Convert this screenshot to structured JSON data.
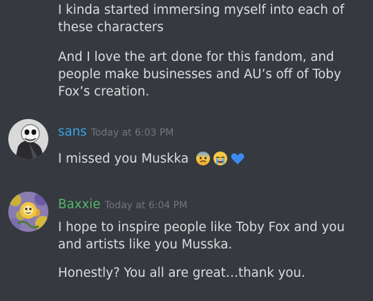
{
  "colors": {
    "background": "#36393f",
    "text": "#dcddde",
    "timestamp": "#72767d",
    "sans_name": "#3aa1e3",
    "baxxie_name": "#52b66c"
  },
  "continuation": {
    "lines": [
      "I kinda started immersing myself into each of these characters",
      "And I love the art done for this fandom, and people make businesses and AU’s off of Toby Fox’s creation."
    ]
  },
  "messages": [
    {
      "author": "sans",
      "timestamp": "Today at 6:03 PM",
      "avatar": "skeleton-avatar",
      "text": "I missed you Muskka",
      "emojis": [
        "anxious-sweat-face-emoji",
        "crying-face-emoji",
        "blue-heart-emoji"
      ]
    },
    {
      "author": "Baxxie",
      "timestamp": "Today at 6:04 PM",
      "avatar": "flower-avatar",
      "lines": [
        "I hope to inspire people like Toby Fox and you and artists like you Musska.",
        "Honestly? You all are great…thank you."
      ]
    }
  ]
}
